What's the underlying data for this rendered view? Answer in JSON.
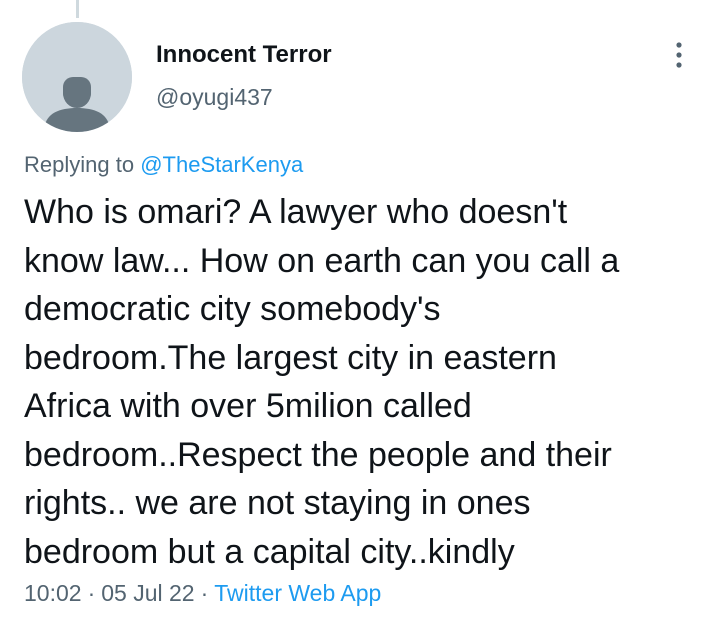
{
  "tweet": {
    "author_name": "Innocent Terror",
    "author_handle": "@oyugi437",
    "replying_prefix": "Replying to",
    "replying_to": "@TheStarKenya",
    "text_lines": [
      "Who is omari?  A lawyer who doesn't",
      "know law... How on earth can you call a",
      "democratic city somebody's",
      "bedroom.The largest city in eastern",
      "Africa with over 5milion called",
      "bedroom..Respect the people and their",
      "rights.. we are not staying in ones",
      "bedroom but a capital city..kindly"
    ],
    "time": "10:02",
    "separator": "·",
    "date": "05 Jul 22",
    "source": "Twitter Web App"
  },
  "icons": {
    "avatar": "default-avatar-icon",
    "more": "more-options-icon"
  },
  "colors": {
    "accent": "#1d9bf0",
    "secondary_text": "#536471",
    "primary_text": "#0f1419",
    "avatar_bg": "#ccd6dd",
    "avatar_figure": "#66757f"
  }
}
